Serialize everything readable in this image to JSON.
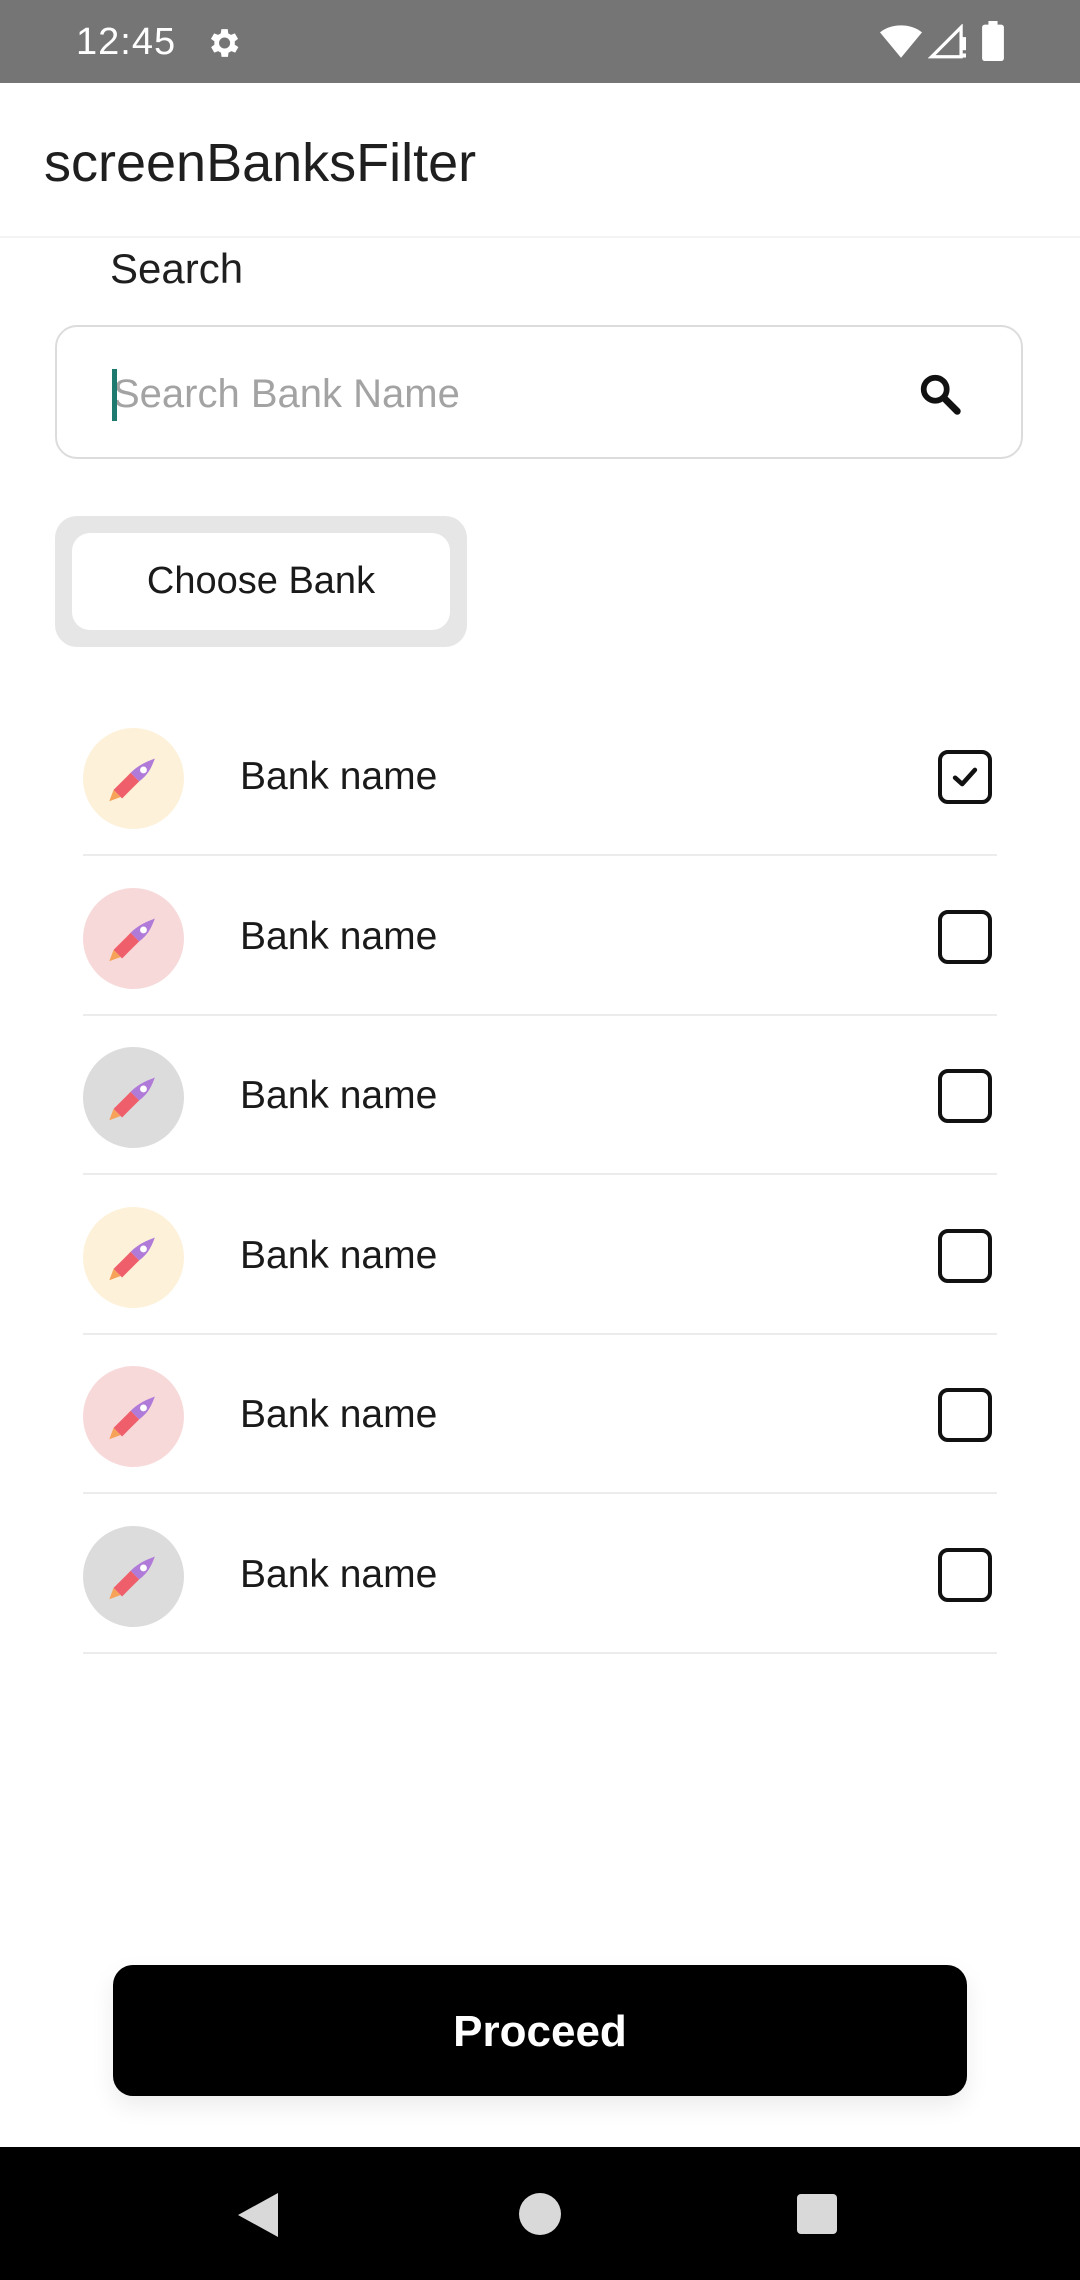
{
  "status_bar": {
    "time": "12:45",
    "icons": [
      "gear-icon",
      "wifi-icon",
      "signal-icon",
      "battery-icon"
    ]
  },
  "app_bar": {
    "title": "screenBanksFilter"
  },
  "search": {
    "label": "Search",
    "placeholder": "Search Bank Name",
    "value": "",
    "icon": "search-icon"
  },
  "choose_bank": {
    "label": "Choose Bank"
  },
  "banks": [
    {
      "name": "Bank name",
      "avatar_color": "#fdf1d9",
      "checked": true
    },
    {
      "name": "Bank name",
      "avatar_color": "#f8d9da",
      "checked": false
    },
    {
      "name": "Bank name",
      "avatar_color": "#dcdcdc",
      "checked": false
    },
    {
      "name": "Bank name",
      "avatar_color": "#fdf1d9",
      "checked": false
    },
    {
      "name": "Bank name",
      "avatar_color": "#f8d9da",
      "checked": false
    },
    {
      "name": "Bank name",
      "avatar_color": "#dcdcdc",
      "checked": false
    }
  ],
  "footer": {
    "proceed_label": "Proceed"
  },
  "colors": {
    "status_bar": "#757575",
    "accent_caret": "#1e7a6f",
    "button": "#000000",
    "button_text": "#ffffff"
  },
  "nav_bar": {
    "icons": [
      "back-icon",
      "home-icon",
      "recents-icon"
    ]
  }
}
